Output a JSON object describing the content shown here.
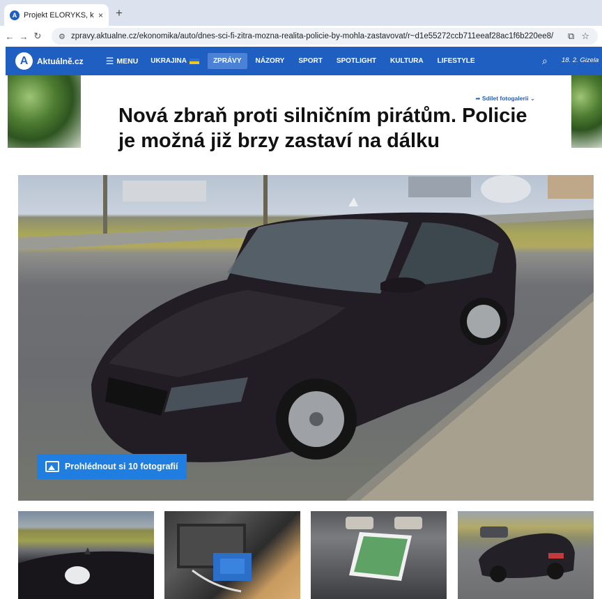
{
  "browser": {
    "tab_title": "Projekt ELORYKS, který řeší",
    "tab_close": "×",
    "new_tab": "+",
    "url": "zpravy.aktualne.cz/ekonomika/auto/dnes-sci-fi-zitra-mozna-realita-policie-by-mohla-zastavovat/r~d1e55272ccb711eeaf28ac1f6b220ee8/"
  },
  "site": {
    "logo_mark": "A",
    "logo_text": "Aktuálně.cz",
    "menu_label": "MENU",
    "nav": [
      {
        "label": "UKRAJINA"
      },
      {
        "label": "ZPRÁVY"
      },
      {
        "label": "NÁZORY"
      },
      {
        "label": "SPORT"
      },
      {
        "label": "SPOTLIGHT"
      },
      {
        "label": "KULTURA"
      },
      {
        "label": "LIFESTYLE"
      }
    ],
    "active_nav": "ZPRÁVY",
    "date_text": "18. 2. Gizela",
    "accent_color": "#1f5fc1"
  },
  "article": {
    "share_label": "Sdílet fotogalerii",
    "headline": "Nová zbraň proti silničním pirátům. Policie je možná již brzy zastaví na dálku",
    "gallery_button": "Prohlédnout si 10 fotografií",
    "thumbnail_count": 4
  },
  "icons": {
    "favicon": "aktualne-logo-icon",
    "back": "arrow-left-icon",
    "forward": "arrow-right-icon",
    "reload": "reload-icon",
    "site_info": "tune-icon",
    "install": "install-app-icon",
    "bookmark": "star-icon",
    "menu": "hamburger-icon",
    "search": "search-icon",
    "share": "share-arrow-icon",
    "gallery": "image-icon"
  }
}
